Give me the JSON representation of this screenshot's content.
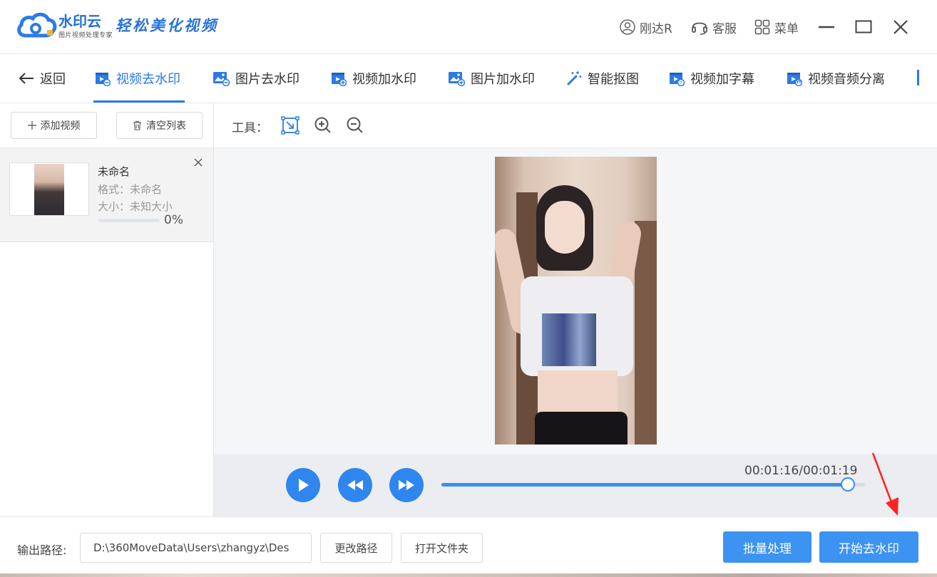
{
  "app": {
    "brand_name": "水印云",
    "brand_sub": "图片视频处理专家",
    "slogan": "轻松美化视频",
    "brand_color": "#2b7be4"
  },
  "titlebar": {
    "user": "刚达R",
    "support": "客服",
    "menu": "菜单"
  },
  "nav": {
    "back": "返回",
    "tabs": [
      {
        "label": "视频去水印",
        "active": true
      },
      {
        "label": "图片去水印"
      },
      {
        "label": "视频加水印"
      },
      {
        "label": "图片加水印"
      },
      {
        "label": "智能抠图"
      },
      {
        "label": "视频加字幕"
      },
      {
        "label": "视频音频分离"
      }
    ]
  },
  "left": {
    "add_label": "添加视频",
    "clear_label": "清空列表",
    "file": {
      "name": "未命名",
      "format": "格式：未命名",
      "size": "大小：未知大小",
      "progress": 0,
      "progress_label": "0%"
    }
  },
  "tools": {
    "label": "工具："
  },
  "player": {
    "time": "00:01:16/00:01:19",
    "progress": 0.96
  },
  "bottom": {
    "output_label": "输出路径:",
    "output_path": "D:\\360MoveData\\Users\\zhangyz\\Des",
    "change_path": "更改路径",
    "open_folder": "打开文件夹",
    "batch": "批量处理",
    "start": "开始去水印"
  }
}
